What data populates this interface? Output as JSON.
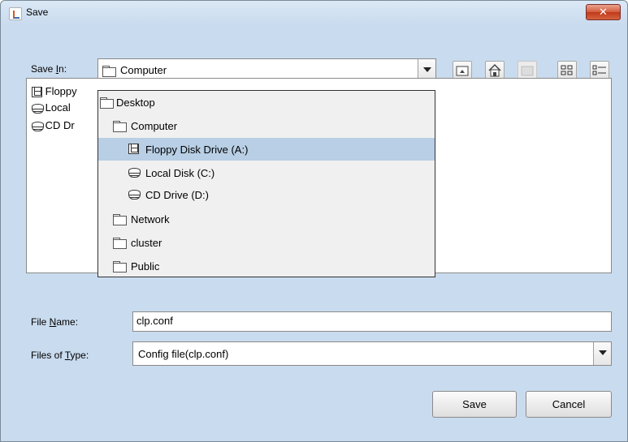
{
  "window": {
    "title": "Save",
    "close_label": "✕"
  },
  "save_in": {
    "label_prefix": "Save ",
    "label_mnemonic": "I",
    "label_suffix": "n:",
    "value": "Computer"
  },
  "toolbar": {
    "buttons": [
      {
        "name": "up-one-level",
        "icon": "up-folder-icon",
        "enabled": true
      },
      {
        "name": "home",
        "icon": "home-icon",
        "enabled": true
      },
      {
        "name": "new-folder",
        "icon": "new-folder-icon",
        "enabled": false
      },
      {
        "name": "list-view",
        "icon": "list-view-icon",
        "enabled": true
      },
      {
        "name": "details-view",
        "icon": "details-view-icon",
        "enabled": true
      }
    ]
  },
  "file_list": {
    "items": [
      {
        "label": "Floppy",
        "icon": "floppy-icon"
      },
      {
        "label": "Local",
        "icon": "disk-icon"
      },
      {
        "label": "CD Dr",
        "icon": "disk-icon"
      }
    ]
  },
  "dropdown": {
    "items": [
      {
        "label": "Desktop",
        "icon": "folder-icon",
        "level": 0,
        "selected": false
      },
      {
        "label": "Computer",
        "icon": "folder-icon",
        "level": 1,
        "selected": false
      },
      {
        "label": "Floppy Disk Drive (A:)",
        "icon": "floppy-icon",
        "level": 2,
        "selected": true
      },
      {
        "label": "Local Disk (C:)",
        "icon": "disk-icon",
        "level": 2,
        "selected": false
      },
      {
        "label": "CD Drive (D:)",
        "icon": "disk-icon",
        "level": 2,
        "selected": false
      },
      {
        "label": "Network",
        "icon": "folder-icon",
        "level": 1,
        "selected": false
      },
      {
        "label": "cluster",
        "icon": "folder-icon",
        "level": 1,
        "selected": false
      },
      {
        "label": "Public",
        "icon": "folder-icon",
        "level": 1,
        "selected": false
      }
    ]
  },
  "file_name": {
    "label_prefix": "File ",
    "label_mnemonic": "N",
    "label_suffix": "ame:",
    "value": "clp.conf"
  },
  "file_type": {
    "label_prefix": "Files of ",
    "label_mnemonic": "T",
    "label_suffix": "ype:",
    "value": "Config file(clp.conf)"
  },
  "buttons": {
    "save": "Save",
    "cancel": "Cancel"
  }
}
